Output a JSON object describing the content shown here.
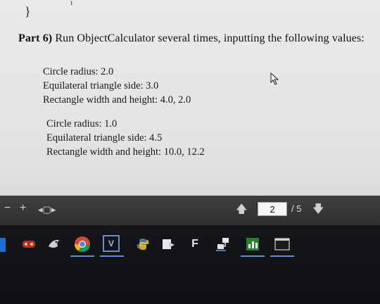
{
  "document": {
    "brace": "}",
    "part_label": "Part 6)",
    "instruction": "Run ObjectCalculator several times, inputting the following values:",
    "group1": [
      "Circle radius: 2.0",
      "Equilateral triangle side: 3.0",
      "Rectangle width and height: 4.0, 2.0"
    ],
    "group2": [
      "Circle radius: 1.0",
      "Equilateral triangle side: 4.5",
      "Rectangle width and height: 10.0, 12.2"
    ]
  },
  "toolbar": {
    "zoom_out": "−",
    "zoom_in": "+",
    "fit": "◂▢▸",
    "current_page": "2",
    "total_pages": "/ 5",
    "prev": "🡅",
    "next": "🡇"
  },
  "taskbar": {
    "icons": [
      "game-icon",
      "bird-icon",
      "chrome-icon",
      "visio-icon",
      "python-icon",
      "arrow-app-icon",
      "file-icon",
      "network-icon",
      "chart-app-icon",
      "terminal-icon"
    ],
    "visio_label": "V",
    "file_label": "F"
  },
  "colors": {
    "doc_bg": "#e6e6e7",
    "toolbar_bg": "#37383a",
    "taskbar_bg": "#131417",
    "accent": "#5a8fd8"
  }
}
